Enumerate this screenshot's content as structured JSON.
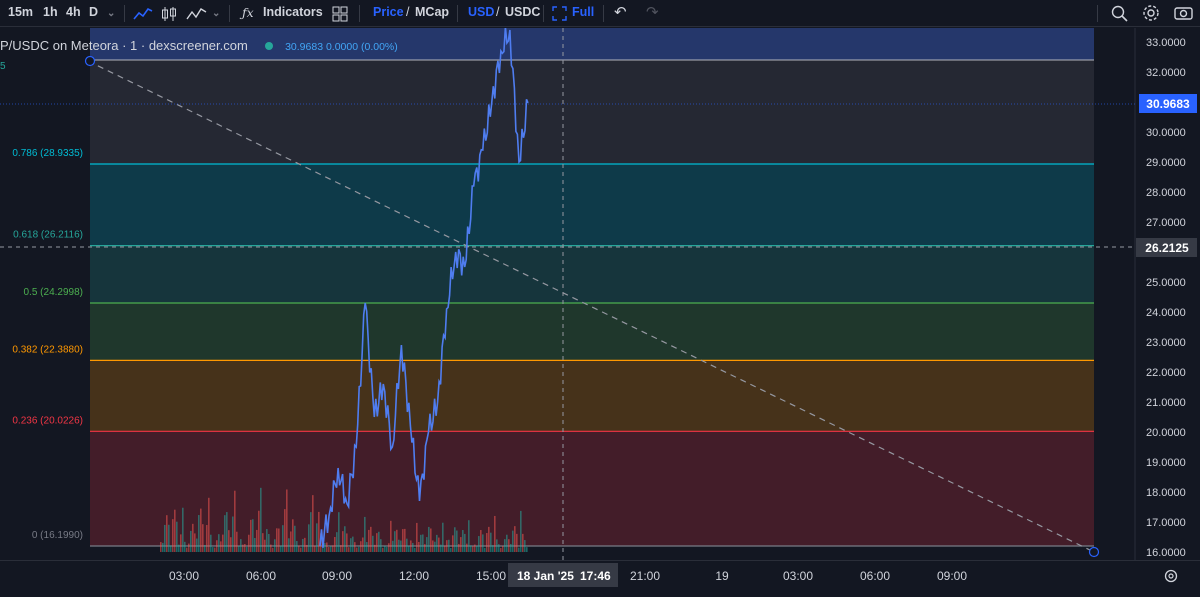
{
  "toolbar": {
    "intervals": [
      "15m",
      "1h",
      "4h",
      "D"
    ],
    "indicators_label": "Indicators",
    "price_label": "Price",
    "mcap_label": "MCap",
    "slash": "/",
    "usd_label": "USD",
    "usdc_label": "USDC",
    "full_label": "Full"
  },
  "legend": {
    "title": "P/USDC on Meteora · 1 · dexscreener.com",
    "values": "30.9683  0.0000 (0.00%)",
    "left_fragment": "5"
  },
  "fib_levels": [
    {
      "label": "0.786 (28.9335)",
      "price": 28.9335,
      "color": "#00bcd4"
    },
    {
      "label": "0.618 (26.2116)",
      "price": 26.2116,
      "color": "#26a69a"
    },
    {
      "label": "0.5 (24.2998)",
      "price": 24.2998,
      "color": "#4caf50"
    },
    {
      "label": "0.382 (22.3880)",
      "price": 22.388,
      "color": "#ff9800"
    },
    {
      "label": "0.236 (20.0226)",
      "price": 20.0226,
      "color": "#f23645"
    },
    {
      "label": "0 (16.1990)",
      "price": 16.199,
      "color": "#787b86"
    }
  ],
  "price_axis": {
    "ticks": [
      "33.0000",
      "32.0000",
      "31.0000",
      "30.0000",
      "29.0000",
      "28.0000",
      "27.0000",
      "26.0000",
      "25.0000",
      "24.0000",
      "23.0000",
      "22.0000",
      "21.0000",
      "20.0000",
      "19.0000",
      "18.0000",
      "17.0000",
      "16.0000"
    ],
    "last_price": "30.9683",
    "crosshair_price": "26.2125"
  },
  "time_axis": {
    "ticks": [
      "03:00",
      "06:00",
      "09:00",
      "12:00",
      "15:00",
      "21:00",
      "19",
      "03:00",
      "06:00",
      "09:00"
    ],
    "crosshair_date": "18 Jan '25",
    "crosshair_time": "17:46"
  },
  "chart_data": {
    "type": "line",
    "series": [
      {
        "x": [
          "08:30",
          "09:00",
          "09:30",
          "10:00",
          "10:30",
          "10:45",
          "11:00",
          "11:30",
          "12:00",
          "12:30",
          "13:00",
          "13:15",
          "13:30",
          "14:00",
          "14:30",
          "15:00",
          "15:15",
          "15:30",
          "16:00",
          "16:15",
          "16:30",
          "17:00",
          "17:15",
          "17:30"
        ],
        "values": [
          16.2,
          17.2,
          18.8,
          17.6,
          19.5,
          24.3,
          20.5,
          21.6,
          19.5,
          22.9,
          20.2,
          17.7,
          20.0,
          21.0,
          24.1,
          26.0,
          25.5,
          28.2,
          29.4,
          31.0,
          32.7,
          33.4,
          29.0,
          30.97
        ]
      }
    ],
    "ylim": [
      16.0,
      33.0
    ],
    "colors": {
      "line": "#4f7df0",
      "volume_up": "#26a69a",
      "volume_down": "#ef5350"
    }
  }
}
